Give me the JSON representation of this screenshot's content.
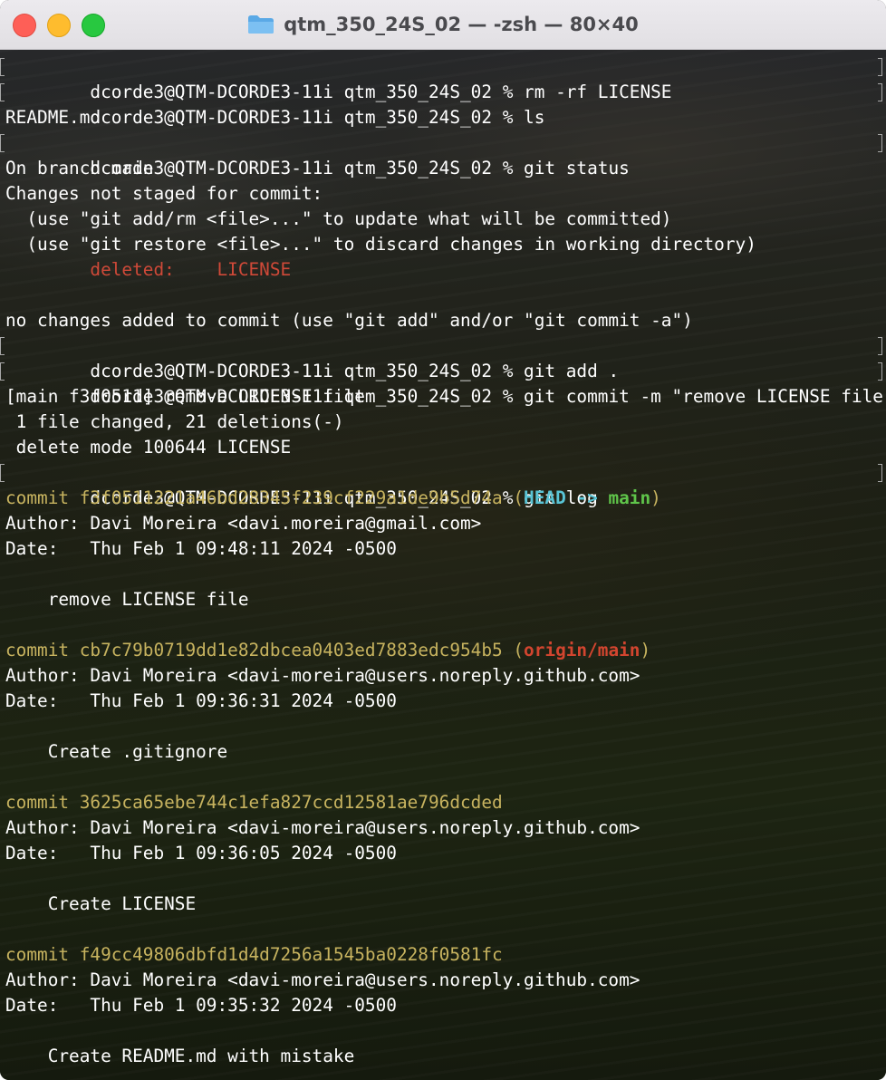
{
  "window": {
    "title": "qtm_350_24S_02 — -zsh — 80×40"
  },
  "prompt": "dcorde3@QTM-DCORDE3-11i qtm_350_24S_02 % ",
  "commands": {
    "rm": "rm -rf LICENSE",
    "ls": "ls",
    "status": "git status",
    "add": "git add .",
    "commit": "git commit -m \"remove LICENSE file\"",
    "log": "git log"
  },
  "output": {
    "ls": "README.md",
    "status_branch": "On branch main",
    "status_header": "Changes not staged for commit:",
    "status_hint1": "  (use \"git add/rm <file>...\" to update what will be committed)",
    "status_hint2": "  (use \"git restore <file>...\" to discard changes in working directory)",
    "deleted_label": "        deleted:    ",
    "deleted_file": "LICENSE",
    "status_footer": "no changes added to commit (use \"git add\" and/or \"git commit -a\")",
    "commit_result": "[main f3f0511] remove LICENSE file",
    "commit_changes": " 1 file changed, 21 deletions(-)",
    "commit_mode": " delete mode 100644 LICENSE"
  },
  "log": [
    {
      "commit": "commit f3f0511221a46bd28345f239cf229a1de9b5d74a",
      "author": "Author: Davi Moreira <davi.moreira@gmail.com>",
      "date": "Date:   Thu Feb 1 09:48:11 2024 -0500",
      "message": "    remove LICENSE file"
    },
    {
      "commit": "commit cb7c79b0719dd1e82dbcea0403ed7883edc954b5",
      "author": "Author: Davi Moreira <davi-moreira@users.noreply.github.com>",
      "date": "Date:   Thu Feb 1 09:36:31 2024 -0500",
      "message": "    Create .gitignore"
    },
    {
      "commit": "commit 3625ca65ebe744c1efa827ccd12581ae796dcded",
      "author": "Author: Davi Moreira <davi-moreira@users.noreply.github.com>",
      "date": "Date:   Thu Feb 1 09:36:05 2024 -0500",
      "message": "    Create LICENSE"
    },
    {
      "commit": "commit f49cc49806dbfd1d4d7256a1545ba0228f0581fc",
      "author": "Author: Davi Moreira <davi-moreira@users.noreply.github.com>",
      "date": "Date:   Thu Feb 1 09:35:32 2024 -0500",
      "message": "    Create README.md with mistake"
    }
  ],
  "refs": {
    "head": "HEAD",
    "arrow": " -> ",
    "main": "main",
    "origin": "origin/main",
    "open": " (",
    "close": ")"
  },
  "colors": {
    "commit_hash": "#c7b35f",
    "deleted": "#cf4938",
    "head": "#59c4d6",
    "branch": "#5fc44a",
    "remote": "#d2452f"
  }
}
